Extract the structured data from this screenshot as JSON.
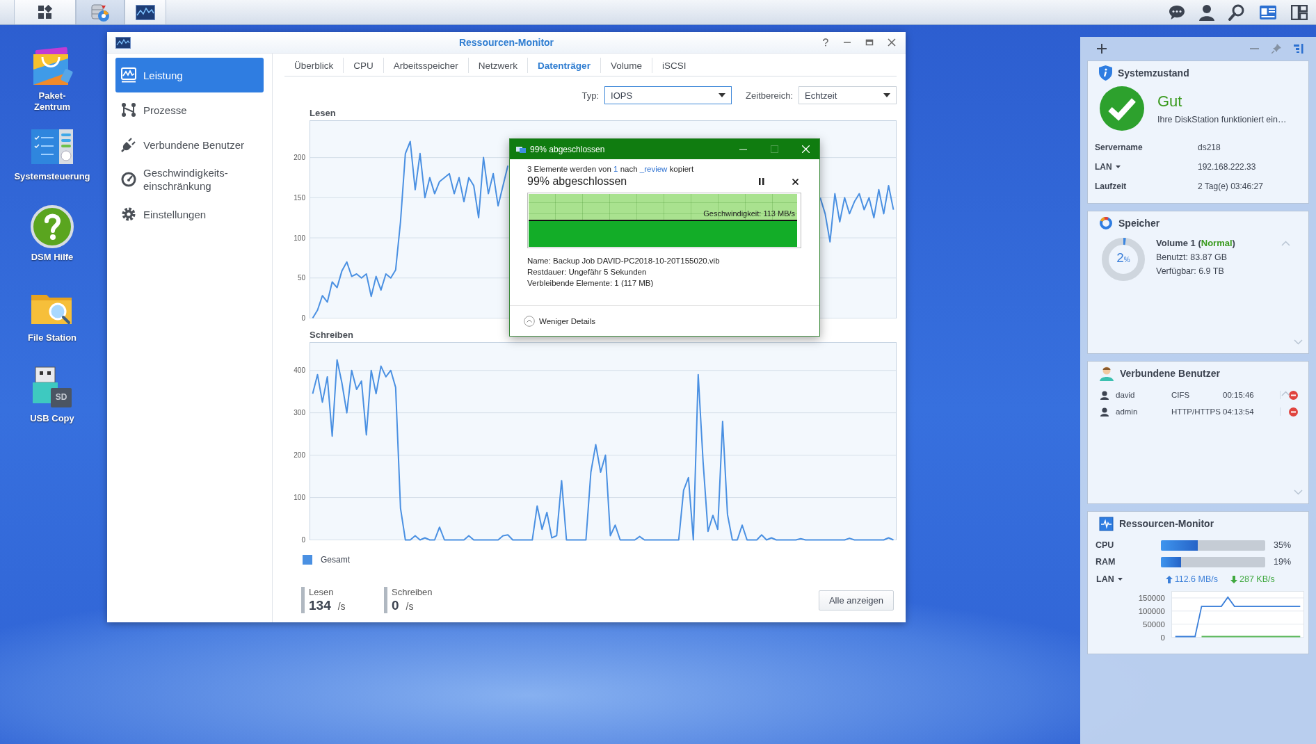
{
  "desktop_icons": [
    {
      "label": "Paket-\nZentrum",
      "kind": "package"
    },
    {
      "label": "Systemsteuerung",
      "kind": "control-panel"
    },
    {
      "label": "DSM Hilfe",
      "kind": "help"
    },
    {
      "label": "File Station",
      "kind": "file-station"
    },
    {
      "label": "USB Copy",
      "kind": "usb-copy",
      "icon_text": "SD"
    }
  ],
  "window": {
    "title": "Ressourcen-Monitor",
    "nav": [
      {
        "label": "Leistung",
        "kind": "performance",
        "selected": true
      },
      {
        "label": "Prozesse",
        "kind": "processes",
        "selected": false
      },
      {
        "label": "Verbundene Benutzer",
        "kind": "users",
        "selected": false
      },
      {
        "label": "Geschwindigkeits-\neinschränkung",
        "kind": "speed-limit",
        "selected": false
      },
      {
        "label": "Einstellungen",
        "kind": "settings",
        "selected": false
      }
    ],
    "tabs": [
      {
        "label": "Überblick",
        "selected": false
      },
      {
        "label": "CPU",
        "selected": false
      },
      {
        "label": "Arbeitsspeicher",
        "selected": false
      },
      {
        "label": "Netzwerk",
        "selected": false
      },
      {
        "label": "Datenträger",
        "selected": true
      },
      {
        "label": "Volume",
        "selected": false
      },
      {
        "label": "iSCSI",
        "selected": false
      }
    ],
    "filters": [
      {
        "label": "Typ:",
        "value": "IOPS",
        "focused": true
      },
      {
        "label": "Zeitbereich:",
        "value": "Echtzeit",
        "focused": false
      }
    ],
    "charts": [
      {
        "chart_data": {
          "type": "line",
          "title": "Lesen",
          "grid": true,
          "ylim": [
            0,
            246
          ],
          "yticks": [
            0,
            50,
            100,
            150,
            200
          ],
          "series": [
            {
              "color": "#4a90e2",
              "values": [
                0,
                10,
                28,
                20,
                45,
                38,
                59,
                70,
                52,
                55,
                50,
                55,
                27,
                52,
                35,
                55,
                50,
                60,
                120,
                205,
                220,
                160,
                205,
                150,
                175,
                155,
                170,
                175,
                180,
                155,
                175,
                145,
                175,
                165,
                125,
                200,
                155,
                180,
                140,
                165,
                190,
                null,
                null,
                null,
                null,
                null,
                null,
                null,
                null,
                null,
                null,
                null,
                null,
                null,
                null,
                null,
                null,
                null,
                null,
                null,
                null,
                null,
                null,
                null,
                null,
                null,
                null,
                null,
                null,
                null,
                null,
                null,
                null,
                null,
                null,
                null,
                null,
                null,
                null,
                null,
                null,
                null,
                null,
                null,
                null,
                null,
                null,
                null,
                null,
                null,
                null,
                null,
                null,
                null,
                null,
                null,
                null,
                null,
                null,
                null,
                null,
                null,
                null,
                null,
                150,
                130,
                95,
                155,
                120,
                150,
                130,
                145,
                155,
                135,
                150,
                125,
                160,
                130,
                165,
                135
              ]
            }
          ]
        }
      },
      {
        "chart_data": {
          "type": "line",
          "title": "Schreiben",
          "grid": true,
          "ylim": [
            0,
            466
          ],
          "yticks": [
            0,
            100,
            200,
            300,
            400
          ],
          "series": [
            {
              "color": "#4a90e2",
              "values": [
                345,
                390,
                325,
                385,
                245,
                425,
                370,
                300,
                400,
                355,
                375,
                248,
                400,
                345,
                410,
                385,
                400,
                360,
                75,
                0,
                0,
                10,
                0,
                5,
                0,
                0,
                30,
                0,
                0,
                0,
                0,
                0,
                10,
                0,
                0,
                0,
                0,
                0,
                0,
                10,
                12,
                0,
                0,
                0,
                0,
                0,
                80,
                25,
                65,
                5,
                10,
                140,
                0,
                0,
                0,
                0,
                0,
                160,
                225,
                160,
                200,
                10,
                35,
                0,
                0,
                0,
                0,
                8,
                0,
                0,
                0,
                0,
                0,
                0,
                0,
                0,
                117,
                147,
                0,
                390,
                185,
                20,
                58,
                25,
                280,
                60,
                0,
                0,
                35,
                0,
                0,
                0,
                12,
                0,
                5,
                0,
                0,
                0,
                0,
                0,
                3,
                0,
                0,
                0,
                0,
                0,
                0,
                0,
                0,
                0,
                4,
                0,
                0,
                0,
                0,
                0,
                0,
                0,
                5,
                0
              ]
            }
          ]
        }
      }
    ],
    "legend": [
      {
        "label": "Gesamt",
        "color": "#4a90e2"
      }
    ],
    "stats": [
      {
        "label": "Lesen",
        "value": "134",
        "unit": "/s"
      },
      {
        "label": "Schreiben",
        "value": "0",
        "unit": "/s"
      }
    ],
    "show_all_button": "Alle anzeigen"
  },
  "copy_dialog": {
    "title": "99% abgeschlossen",
    "summary": {
      "before": "3 Elemente werden von",
      "source": "1",
      "middle": "nach",
      "destination": "_review",
      "after": "kopiert"
    },
    "heading": "99% abgeschlossen",
    "level": 0.99,
    "speed": "Geschwindigkeit: 113 MB/s",
    "details": [
      "Name: Backup Job DAVID-PC2018-10-20T155020.vib",
      "Restdauer: Ungefähr 5 Sekunden",
      "Verbleibende Elemente: 1 (117 MB)"
    ],
    "toggle": "Weniger Details"
  },
  "widgets": {
    "system_health": {
      "title": "Systemzustand",
      "status": "Gut",
      "message": "Ihre DiskStation funktioniert ein…",
      "rows": [
        {
          "label": "Servername",
          "value": "ds218",
          "has_menu": false
        },
        {
          "label": "LAN",
          "value": "192.168.222.33",
          "has_menu": true
        },
        {
          "label": "Laufzeit",
          "value": "2 Tag(e) 03:46:27",
          "has_menu": false
        }
      ]
    },
    "storage": {
      "title": "Speicher",
      "usage": "2",
      "usage_unit": "%",
      "level": 0.02,
      "volume": {
        "before": "Volume 1 (",
        "status": "Normal",
        "after": ")"
      },
      "used": "Benutzt: 83.87 GB",
      "available": "Verfügbar: 6.9 TB"
    },
    "connected_users": {
      "title": "Verbundene Benutzer",
      "rows": [
        {
          "name": "david",
          "protocol": "CIFS",
          "time": "00:15:46"
        },
        {
          "name": "admin",
          "protocol": "HTTP/HTTPS",
          "time": "04:13:54"
        }
      ]
    },
    "resource_monitor": {
      "title": "Ressourcen-Monitor",
      "meters": [
        {
          "label": "CPU",
          "level": 0.35,
          "reading": "35%"
        },
        {
          "label": "RAM",
          "level": 0.19,
          "reading": "19%"
        }
      ],
      "lan": {
        "label": "LAN",
        "upload": "112.6 MB/s",
        "download": "287 KB/s"
      },
      "chart_data": {
        "type": "line",
        "ylim": [
          0,
          175000
        ],
        "yticks": [
          0,
          50000,
          100000,
          150000
        ],
        "series": [
          {
            "color": "#3b7fd9",
            "values": [
              0,
              0,
              0,
              0,
              115000,
              115000,
              115000,
              115000,
              150000,
              115000,
              115000,
              115000,
              115000,
              115000,
              115000,
              115000,
              115000,
              115000,
              115000,
              115000
            ]
          },
          {
            "color": "#5cb85c",
            "values": [
              null,
              null,
              null,
              null,
              0,
              0,
              0,
              0,
              0,
              0,
              0,
              0,
              0,
              0,
              0,
              0,
              0,
              0,
              0,
              0
            ]
          }
        ],
        "grid": true
      }
    }
  }
}
